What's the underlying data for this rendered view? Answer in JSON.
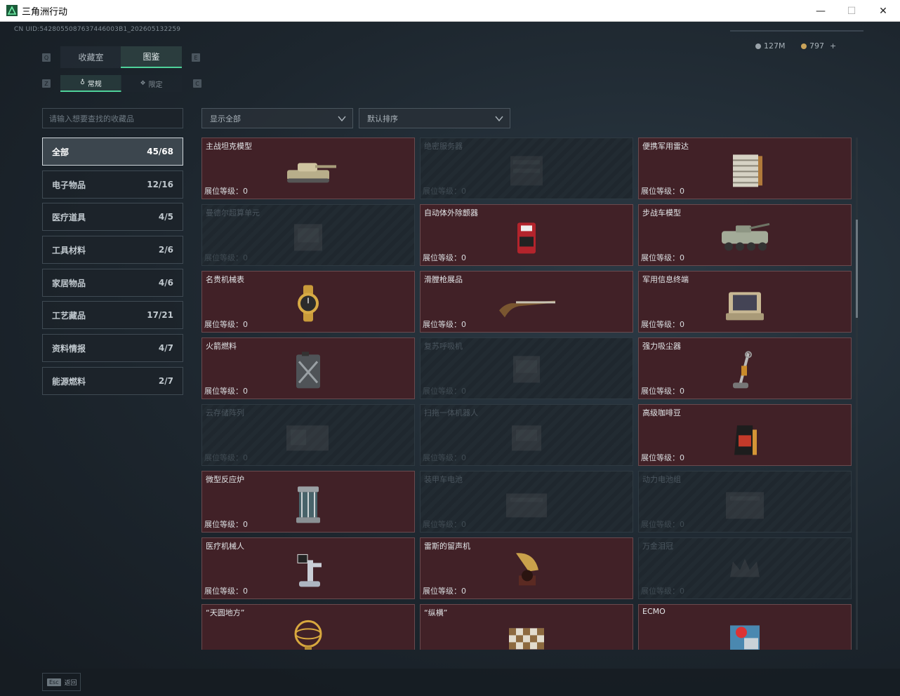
{
  "window": {
    "title": "三角洲行动",
    "minimize": "—",
    "maximize": "☐",
    "close": "✕"
  },
  "header": {
    "uid": "CN UID:5428055087637446003B1_202605132259",
    "currency_a": "127M",
    "currency_b": "797",
    "add": "+"
  },
  "tabs": {
    "key_left": "Q",
    "key_right": "E",
    "main": [
      {
        "label": "收藏室"
      },
      {
        "label": "图鉴"
      }
    ],
    "sub_key_left": "Z",
    "sub_key_right": "C",
    "sub": [
      {
        "label": "常规"
      },
      {
        "label": "限定"
      }
    ]
  },
  "search": {
    "placeholder": "请输入想要查找的收藏品"
  },
  "filters": {
    "show": "显示全部",
    "sort": "默认排序"
  },
  "categories": [
    {
      "label": "全部",
      "count": "45/68"
    },
    {
      "label": "电子物品",
      "count": "12/16"
    },
    {
      "label": "医疗道具",
      "count": "4/5"
    },
    {
      "label": "工具材料",
      "count": "2/6"
    },
    {
      "label": "家居物品",
      "count": "4/6"
    },
    {
      "label": "工艺藏品",
      "count": "17/21"
    },
    {
      "label": "资料情报",
      "count": "4/7"
    },
    {
      "label": "能源燃料",
      "count": "2/7"
    }
  ],
  "level_label": "展位等级：",
  "items": [
    {
      "name": "主战坦克模型",
      "level": "0",
      "locked": false,
      "icon": "tank-icon"
    },
    {
      "name": "绝密服务器",
      "level": "0",
      "locked": true,
      "icon": "server-icon"
    },
    {
      "name": "便携军用雷达",
      "level": "0",
      "locked": false,
      "icon": "radar-icon"
    },
    {
      "name": "曼德尔超算单元",
      "level": "0",
      "locked": true,
      "icon": "computer-unit-icon"
    },
    {
      "name": "自动体外除颤器",
      "level": "0",
      "locked": false,
      "icon": "defibrillator-icon"
    },
    {
      "name": "步战车模型",
      "level": "0",
      "locked": false,
      "icon": "ifv-icon"
    },
    {
      "name": "名贵机械表",
      "level": "0",
      "locked": false,
      "icon": "watch-icon"
    },
    {
      "name": "滑膛枪展品",
      "level": "0",
      "locked": false,
      "icon": "musket-icon"
    },
    {
      "name": "军用信息终端",
      "level": "0",
      "locked": false,
      "icon": "terminal-icon"
    },
    {
      "name": "火箭燃料",
      "level": "0",
      "locked": false,
      "icon": "fuel-can-icon"
    },
    {
      "name": "复苏呼吸机",
      "level": "0",
      "locked": true,
      "icon": "ventilator-icon"
    },
    {
      "name": "强力吸尘器",
      "level": "0",
      "locked": false,
      "icon": "vacuum-icon"
    },
    {
      "name": "云存储阵列",
      "level": "0",
      "locked": true,
      "icon": "storage-array-icon"
    },
    {
      "name": "扫拖一体机器人",
      "level": "0",
      "locked": true,
      "icon": "robot-mop-icon"
    },
    {
      "name": "高级咖啡豆",
      "level": "0",
      "locked": false,
      "icon": "coffee-bag-icon"
    },
    {
      "name": "微型反应炉",
      "level": "0",
      "locked": false,
      "icon": "reactor-icon"
    },
    {
      "name": "装甲车电池",
      "level": "0",
      "locked": true,
      "icon": "battery-icon"
    },
    {
      "name": "动力电池组",
      "level": "0",
      "locked": true,
      "icon": "battery-pack-icon"
    },
    {
      "name": "医疗机械人",
      "level": "0",
      "locked": false,
      "icon": "medical-robot-icon"
    },
    {
      "name": "雷斯的留声机",
      "level": "0",
      "locked": false,
      "icon": "gramophone-icon"
    },
    {
      "name": "万金泪冠",
      "level": "0",
      "locked": true,
      "icon": "crown-icon"
    },
    {
      "name": "“天圆地方”",
      "level": "",
      "locked": false,
      "icon": "armillary-icon"
    },
    {
      "name": "“纵横”",
      "level": "",
      "locked": false,
      "icon": "chessboard-icon"
    },
    {
      "name": "ECMO",
      "level": "",
      "locked": false,
      "icon": "ecmo-icon"
    }
  ],
  "footer": {
    "key": "Esc",
    "label": "返回"
  },
  "colors": {
    "accent": "#4fd29a",
    "unlocked_bg": "#412127",
    "locked_bg": "#1f272e"
  }
}
